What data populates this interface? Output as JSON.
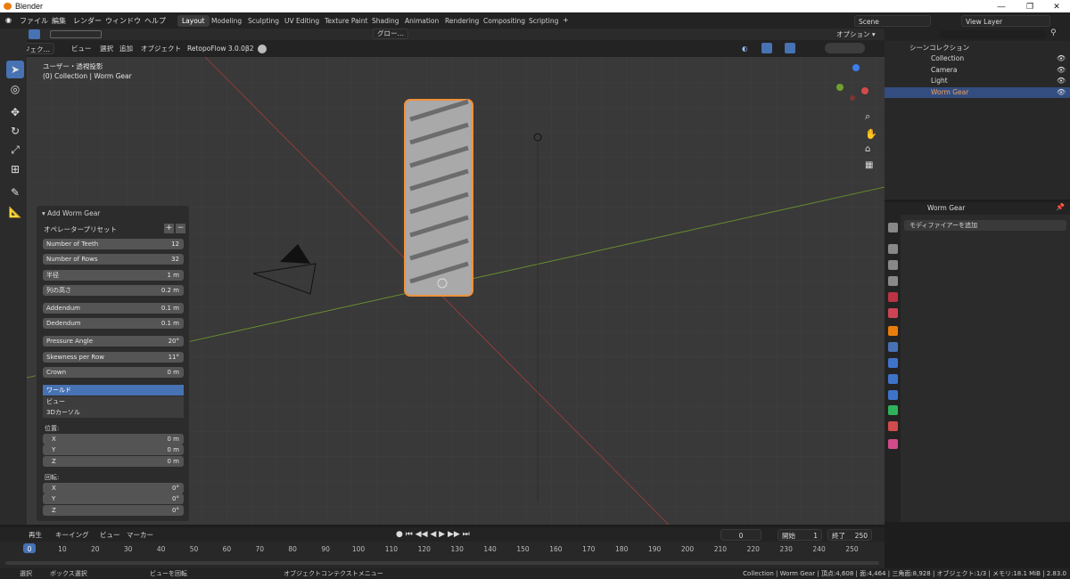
{
  "app": {
    "title": "Blender"
  },
  "menu": [
    "ファイル",
    "編集",
    "レンダー",
    "ウィンドウ",
    "ヘルプ"
  ],
  "workspaces": [
    "Layout",
    "Modeling",
    "Sculpting",
    "UV Editing",
    "Texture Paint",
    "Shading",
    "Animation",
    "Rendering",
    "Compositing",
    "Scripting"
  ],
  "scene": {
    "name": "Scene",
    "view_layer": "View Layer"
  },
  "viewport_header": {
    "mode": "オブジェク…",
    "menus": [
      "ビュー",
      "選択",
      "追加",
      "オブジェクト"
    ],
    "addon": "RetopoFlow 3.0.0β2",
    "transform": "グロー…",
    "options": "オプション"
  },
  "viewport": {
    "view_name": "ユーザー・透視投影",
    "context": "(0) Collection | Worm Gear"
  },
  "operator_panel": {
    "title": "Add Worm Gear",
    "preset": "オペレータープリセット",
    "fields": [
      {
        "label": "Number of Teeth",
        "value": "12"
      },
      {
        "label": "Number of Rows",
        "value": "32"
      },
      {
        "label": "半径",
        "value": "1 m"
      },
      {
        "label": "列の高さ",
        "value": "0.2 m"
      },
      {
        "label": "Addendum",
        "value": "0.1 m"
      },
      {
        "label": "Dedendum",
        "value": "0.1 m"
      },
      {
        "label": "Pressure Angle",
        "value": "20°"
      },
      {
        "label": "Skewness per Row",
        "value": "11°"
      },
      {
        "label": "Crown",
        "value": "0 m"
      }
    ],
    "align_options": [
      "ワールド",
      "ビュー",
      "3Dカーソル"
    ],
    "location_label": "位置:",
    "location": [
      {
        "axis": "X",
        "value": "0 m"
      },
      {
        "axis": "Y",
        "value": "0 m"
      },
      {
        "axis": "Z",
        "value": "0 m"
      }
    ],
    "rotation_label": "回転:",
    "rotation": [
      {
        "axis": "X",
        "value": "0°"
      },
      {
        "axis": "Y",
        "value": "0°"
      },
      {
        "axis": "Z",
        "value": "0°"
      }
    ]
  },
  "outliner": {
    "root": "シーンコレクション",
    "collection": "Collection",
    "items": [
      "Camera",
      "Light",
      "Worm Gear"
    ]
  },
  "properties": {
    "object": "Worm Gear",
    "add_modifier": "モディファイアーを追加"
  },
  "timeline": {
    "menus": [
      "再生",
      "キーイング",
      "ビュー",
      "マーカー"
    ],
    "current_frame": "0",
    "start_label": "開始",
    "start": "1",
    "end_label": "終了",
    "end": "250",
    "ticks": [
      "0",
      "10",
      "20",
      "30",
      "40",
      "50",
      "60",
      "70",
      "80",
      "90",
      "100",
      "110",
      "120",
      "130",
      "140",
      "150",
      "160",
      "170",
      "180",
      "190",
      "200",
      "210",
      "220",
      "230",
      "240",
      "250"
    ]
  },
  "statusbar": {
    "select": "選択",
    "box_select": "ボックス選択",
    "rotate_view": "ビューを回転",
    "context_menu": "オブジェクトコンテクストメニュー",
    "stats": "Collection | Worm Gear | 頂点:4,608 | 面:4,464 | 三角面:8,928 | オブジェクト:1/3 | メモリ:18.1 MiB | 2.83.0"
  }
}
